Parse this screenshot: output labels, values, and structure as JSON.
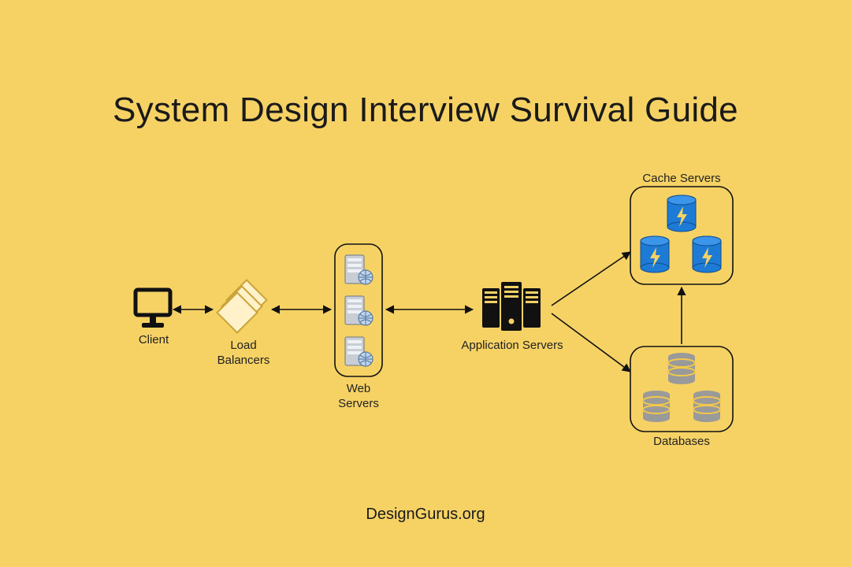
{
  "title": "System Design Interview Survival Guide",
  "footer": "DesignGurus.org",
  "nodes": {
    "client": {
      "label": "Client"
    },
    "load_balancers": {
      "label": "Load\nBalancers"
    },
    "web_servers": {
      "label": "Web\nServers"
    },
    "application_servers": {
      "label": "Application Servers"
    },
    "cache_servers": {
      "label": "Cache Servers"
    },
    "databases": {
      "label": "Databases"
    }
  },
  "edges": [
    {
      "from": "client",
      "to": "load_balancers",
      "bidirectional": true
    },
    {
      "from": "load_balancers",
      "to": "web_servers",
      "bidirectional": true
    },
    {
      "from": "web_servers",
      "to": "application_servers",
      "bidirectional": true
    },
    {
      "from": "application_servers",
      "to": "cache_servers",
      "bidirectional": false
    },
    {
      "from": "application_servers",
      "to": "databases",
      "bidirectional": false
    },
    {
      "from": "databases",
      "to": "cache_servers",
      "bidirectional": false
    }
  ],
  "colors": {
    "background": "#f6d265",
    "stroke": "#111111",
    "cache_fill": "#1d7bd6",
    "db_fill": "#9a9a9a",
    "db_ring": "#f2c84b",
    "lb_fill": "#fff1c9",
    "lb_stroke": "#caa43a"
  }
}
